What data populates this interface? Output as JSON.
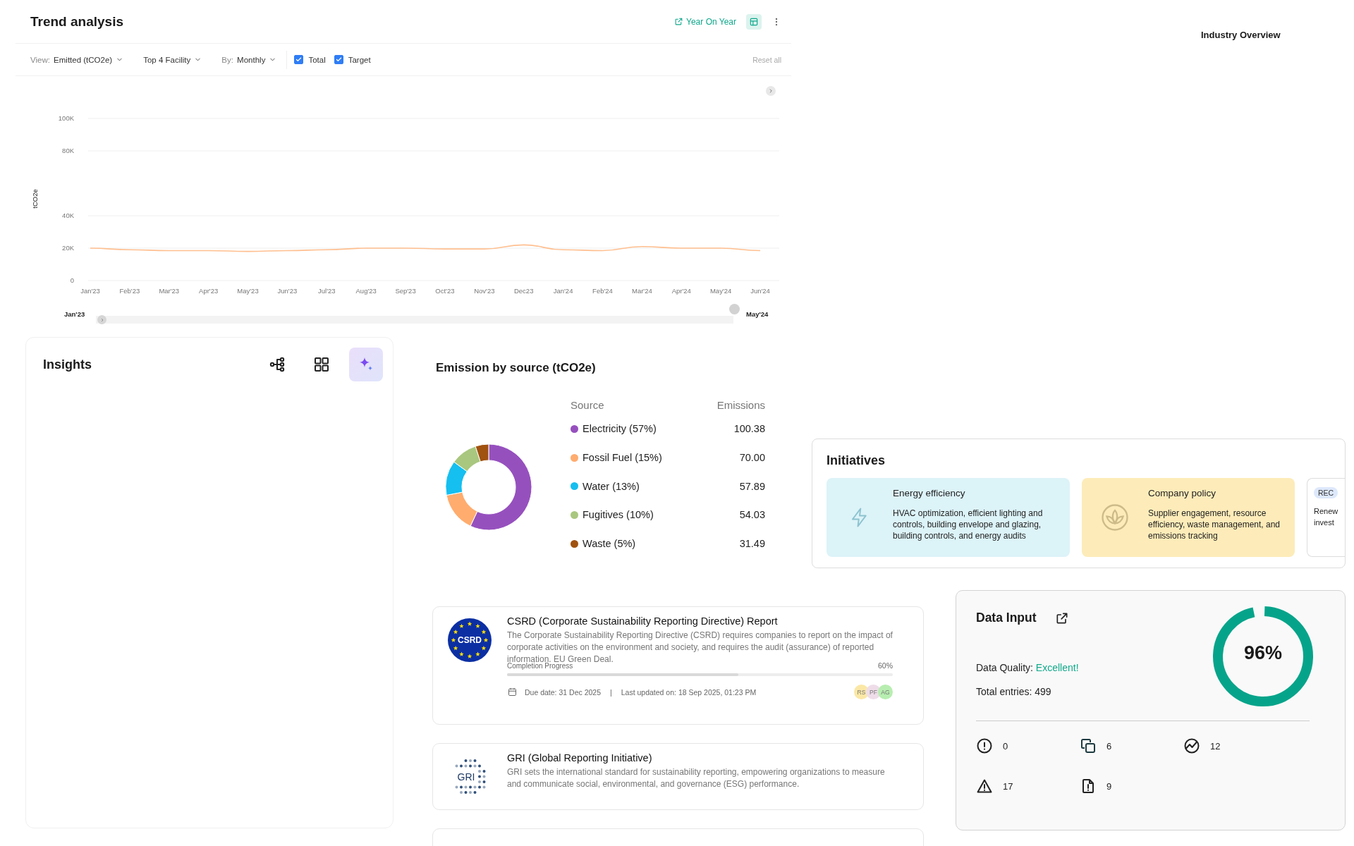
{
  "trend_analysis": {
    "title": "Trend analysis",
    "year_on_year_link": "Year On Year",
    "table_button": {
      "selected": true
    },
    "filters": [
      {
        "kind": "dropdown",
        "label": "View:",
        "value": "Emitted (tCO2e)"
      },
      {
        "kind": "dropdown",
        "value": "Top 4 Facility"
      },
      {
        "kind": "dropdown",
        "label": "By:",
        "value": "Monthly"
      },
      {
        "kind": "checkbox",
        "label": "Total",
        "checked": true
      },
      {
        "kind": "checkbox",
        "label": "Target",
        "checked": true
      }
    ],
    "reset": {
      "label": "Reset all",
      "disabled": true
    },
    "chart_data": {
      "type": "line",
      "ylabel": "tCO2e",
      "categories": [
        "Jan'23",
        "Feb'23",
        "Mar'23",
        "Apr'23",
        "May'23",
        "Jun'23",
        "Jul'23",
        "Aug'23",
        "Sep'23",
        "Oct'23",
        "Nov'23",
        "Dec23",
        "Jan'24",
        "Feb'24",
        "Mar'24",
        "Apr'24",
        "May'24",
        "Jun'24"
      ],
      "series": [
        {
          "color": "#ffbf8f",
          "values": [
            20000,
            19000,
            18500,
            18500,
            18000,
            18500,
            19000,
            20000,
            20000,
            19500,
            19500,
            22000,
            19000,
            18500,
            21000,
            20000,
            20000,
            18500
          ]
        }
      ],
      "grid": true,
      "ylim": [
        0,
        100000
      ],
      "yticks": [
        {
          "value": 0,
          "label": "0"
        },
        {
          "value": 20000,
          "label": "20K"
        },
        {
          "value": 40000,
          "label": "40K"
        },
        {
          "value": 80000,
          "label": "80K"
        },
        {
          "value": 100000,
          "label": "100K"
        }
      ]
    },
    "range": {
      "start": "Jan'23",
      "end": "May'24",
      "level": 1
    }
  },
  "industry_overview": {
    "title": "Industry Overview"
  },
  "insights": {
    "title": "Insights",
    "tools": [
      {
        "kind": "hierarchy",
        "selected": false
      },
      {
        "kind": "grid",
        "selected": false
      },
      {
        "kind": "sparkle",
        "selected": true
      }
    ]
  },
  "emission_by_source": {
    "title": "Emission by source (tCO2e)",
    "columns": [
      "Source",
      "Emissions"
    ],
    "rows": [
      {
        "source": "Electricity (57%)",
        "emissions": "100.38",
        "color": "#9650be"
      },
      {
        "source": "Fossil Fuel (15%)",
        "emissions": "70.00",
        "color": "#ffac6e"
      },
      {
        "source": "Water (13%)",
        "emissions": "57.89",
        "color": "#15bff0"
      },
      {
        "source": "Fugitives (10%)",
        "emissions": "54.03",
        "color": "#a9c77f"
      },
      {
        "source": "Waste (5%)",
        "emissions": "31.49",
        "color": "#a0520f"
      }
    ],
    "chart_data": {
      "type": "donut",
      "values": [
        57,
        15,
        13,
        10,
        5
      ]
    }
  },
  "initiatives": {
    "title": "Initiatives",
    "cards": [
      {
        "kind": "energy",
        "title": "Energy efficiency",
        "text": "HVAC optimization, efficient lighting and controls, building envelope and glazing, building controls, and energy audits",
        "color": "#dcf3f8"
      },
      {
        "kind": "policy",
        "title": "Company policy",
        "text": "Supplier engagement, resource efficiency, waste management, and emissions tracking",
        "color": "#fdecb9"
      },
      {
        "kind": "tagged",
        "tag": "REC",
        "text": "Renew invest"
      }
    ]
  },
  "reports": [
    {
      "kind": "csrd",
      "logo_text": "CSRD",
      "title": "CSRD (Corporate Sustainability Reporting Directive) Report",
      "description": "The Corporate Sustainability Reporting Directive (CSRD) requires companies to report on the impact of corporate activities on the environment and society, and requires the audit (assurance) of reported information. EU Green Deal.",
      "progress_label": "Completion Progress",
      "progress_text": "60%",
      "level": 0.6,
      "due": "Due date: 31 Dec 2025",
      "separator": "|",
      "updated": "Last updated on: 18 Sep 2025, 01:23 PM",
      "avatars": [
        {
          "initials": "RS",
          "color": "#fbe8a6"
        },
        {
          "initials": "PF",
          "color": "#eedde9"
        },
        {
          "initials": "AG",
          "color": "#b7eeb0"
        }
      ]
    },
    {
      "kind": "gri",
      "logo_text": "GRI",
      "title": "GRI (Global Reporting Initiative)",
      "description": "GRI sets the international standard for sustainability reporting, empowering organizations to measure and communicate social, environmental, and governance (ESG) performance."
    },
    {
      "kind": "empty"
    }
  ],
  "data_input": {
    "title": "Data Input",
    "quality_label": "Data Quality:",
    "quality_value": "Excellent!",
    "total": "Total entries: 499",
    "score": "96%",
    "level": 0.96,
    "stats": [
      {
        "kind": "alert",
        "value": "0"
      },
      {
        "kind": "copy",
        "value": "6"
      },
      {
        "kind": "trend",
        "value": "12"
      },
      {
        "kind": "warning",
        "value": "17"
      },
      {
        "kind": "file",
        "value": "9"
      }
    ]
  }
}
